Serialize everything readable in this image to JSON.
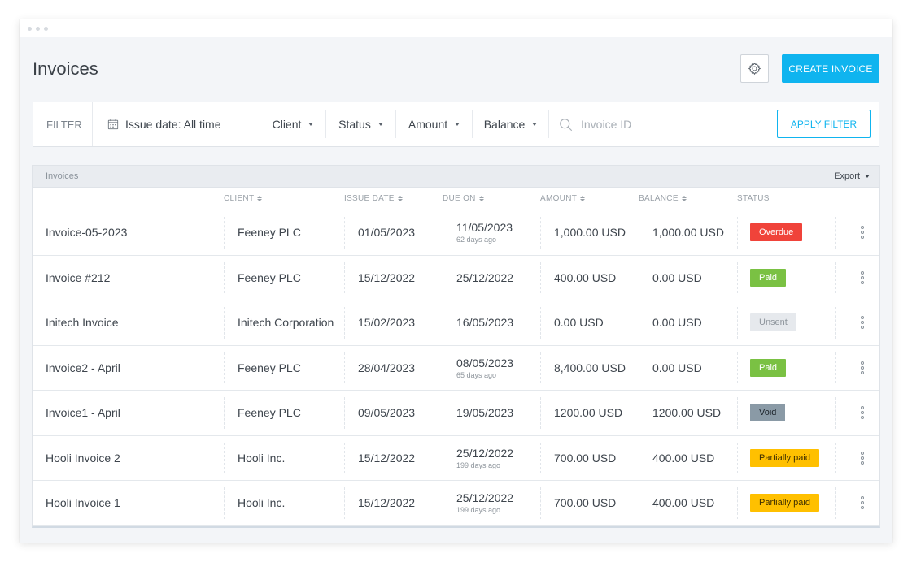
{
  "page": {
    "title": "Invoices",
    "create_label": "CREATE INVOICE"
  },
  "filter": {
    "label": "FILTER",
    "issue_date": "Issue date: All time",
    "client": "Client",
    "status": "Status",
    "amount": "Amount",
    "balance": "Balance",
    "search_placeholder": "Invoice ID",
    "apply_label": "APPLY FILTER"
  },
  "table": {
    "title": "Invoices",
    "export_label": "Export",
    "columns": {
      "client": "CLIENT",
      "issue_date": "ISSUE DATE",
      "due_on": "DUE ON",
      "amount": "AMOUNT",
      "balance": "BALANCE",
      "status": "STATUS"
    },
    "rows": [
      {
        "name": "Invoice-05-2023",
        "client": "Feeney PLC",
        "issue_date": "01/05/2023",
        "due_on": "11/05/2023",
        "due_sub": "62 days ago",
        "amount": "1,000.00 USD",
        "balance": "1,000.00 USD",
        "status": "Overdue",
        "status_bg": "#f0433a",
        "status_fg": "#ffffff"
      },
      {
        "name": "Invoice #212",
        "client": "Feeney PLC",
        "issue_date": "15/12/2022",
        "due_on": "25/12/2022",
        "due_sub": "",
        "amount": "400.00 USD",
        "balance": "0.00 USD",
        "status": "Paid",
        "status_bg": "#7ac143",
        "status_fg": "#ffffff"
      },
      {
        "name": "Initech Invoice",
        "client": "Initech Corporation",
        "issue_date": "15/02/2023",
        "due_on": "16/05/2023",
        "due_sub": "",
        "amount": "0.00 USD",
        "balance": "0.00 USD",
        "status": "Unsent",
        "status_bg": "#e6e9ed",
        "status_fg": "#8e959c"
      },
      {
        "name": "Invoice2 - April",
        "client": "Feeney PLC",
        "issue_date": "28/04/2023",
        "due_on": "08/05/2023",
        "due_sub": "65 days ago",
        "amount": "8,400.00 USD",
        "balance": "0.00 USD",
        "status": "Paid",
        "status_bg": "#7ac143",
        "status_fg": "#ffffff"
      },
      {
        "name": "Invoice1 - April",
        "client": "Feeney PLC",
        "issue_date": "09/05/2023",
        "due_on": "19/05/2023",
        "due_sub": "",
        "amount": "1200.00 USD",
        "balance": "1200.00 USD",
        "status": "Void",
        "status_bg": "#8a9aa6",
        "status_fg": "#1f262d"
      },
      {
        "name": "Hooli Invoice 2",
        "client": "Hooli Inc.",
        "issue_date": "15/12/2022",
        "due_on": "25/12/2022",
        "due_sub": "199 days ago",
        "amount": "700.00 USD",
        "balance": "400.00 USD",
        "status": "Partially paid",
        "status_bg": "#ffc000",
        "status_fg": "#3e2e00"
      },
      {
        "name": "Hooli Invoice 1",
        "client": "Hooli Inc.",
        "issue_date": "15/12/2022",
        "due_on": "25/12/2022",
        "due_sub": "199 days ago",
        "amount": "700.00 USD",
        "balance": "400.00 USD",
        "status": "Partially paid",
        "status_bg": "#ffc000",
        "status_fg": "#3e2e00"
      }
    ]
  }
}
